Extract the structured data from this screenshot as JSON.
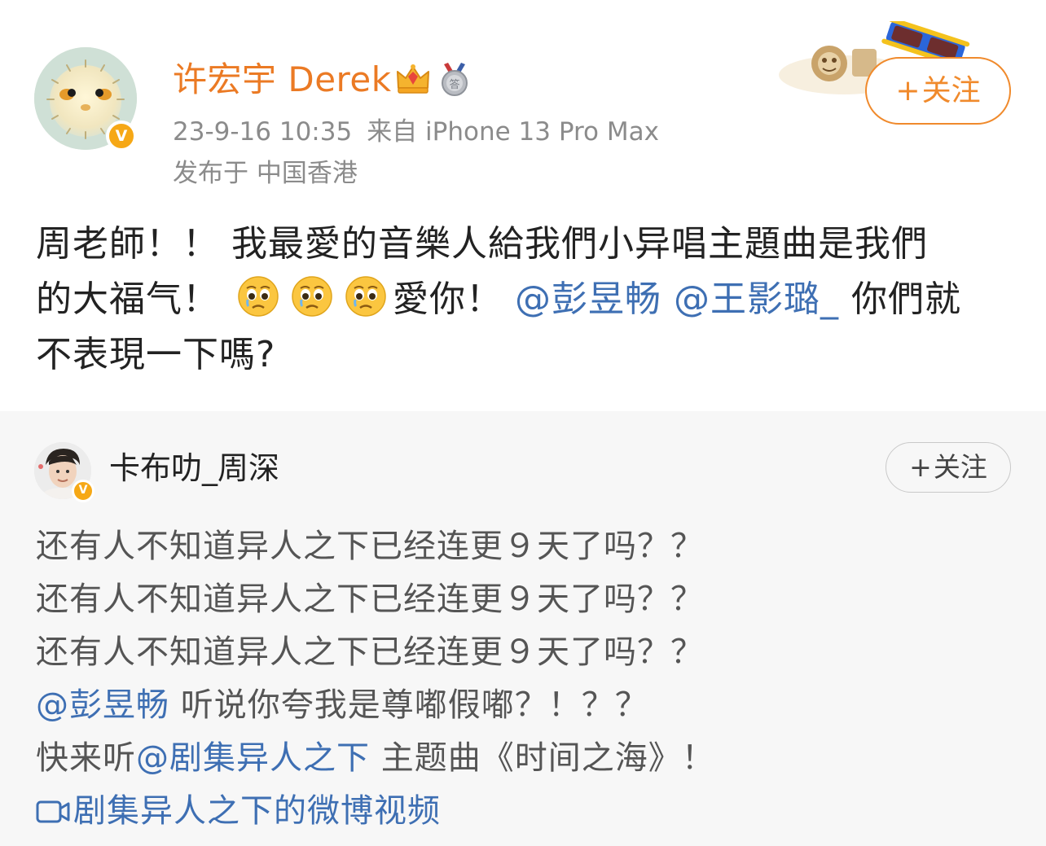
{
  "post": {
    "author": {
      "name": "许宏宇 Derek",
      "verified_badge": "V",
      "badges": [
        "crown-icon",
        "medal-icon"
      ],
      "avatar": "pufferfish-avatar"
    },
    "timestamp": "23-9-16 10:35",
    "source": "来自 iPhone 13 Pro Max",
    "location": "发布于 中国香港",
    "follow_button": {
      "plus": "+",
      "label": "关注"
    },
    "content": {
      "line1": "周老師！！ 我最愛的音樂人給我們小异唱主題曲是我們",
      "line2_text_a": "的大福气！",
      "line2_emoji": [
        "crying-face-emoji",
        "crying-face-emoji",
        "crying-face-emoji"
      ],
      "line2_text_b": "愛你！",
      "line2_mention1": "@彭昱畅",
      "line2_mention2": "@王影璐_",
      "line2_text_c": "你們就",
      "line3": "不表現一下嗎?"
    }
  },
  "repost": {
    "author": {
      "name": "卡布叻_周深",
      "verified_badge": "V",
      "avatar": "portrait-avatar"
    },
    "follow_button": {
      "plus": "+",
      "label": "关注"
    },
    "lines": {
      "l1": "还有人不知道异人之下已经连更９天了吗？？",
      "l2": "还有人不知道异人之下已经连更９天了吗？？",
      "l3": "还有人不知道异人之下已经连更９天了吗？？",
      "l4_mention": "@彭昱畅",
      "l4_text": "听说你夸我是尊嘟假嘟？！？？",
      "l5_text_a": "快来听",
      "l5_mention": "@剧集异人之下",
      "l5_text_b": "主题曲《时间之海》！",
      "l6_link": "剧集异人之下的微博视频"
    }
  },
  "colors": {
    "author_orange": "#eb7a24",
    "follow_orange": "#f08a2c",
    "mention_blue": "#3e6fb3",
    "meta_gray": "#8b8b8b",
    "repost_bg": "#f7f7f7",
    "verified_gold": "#f6a816"
  }
}
